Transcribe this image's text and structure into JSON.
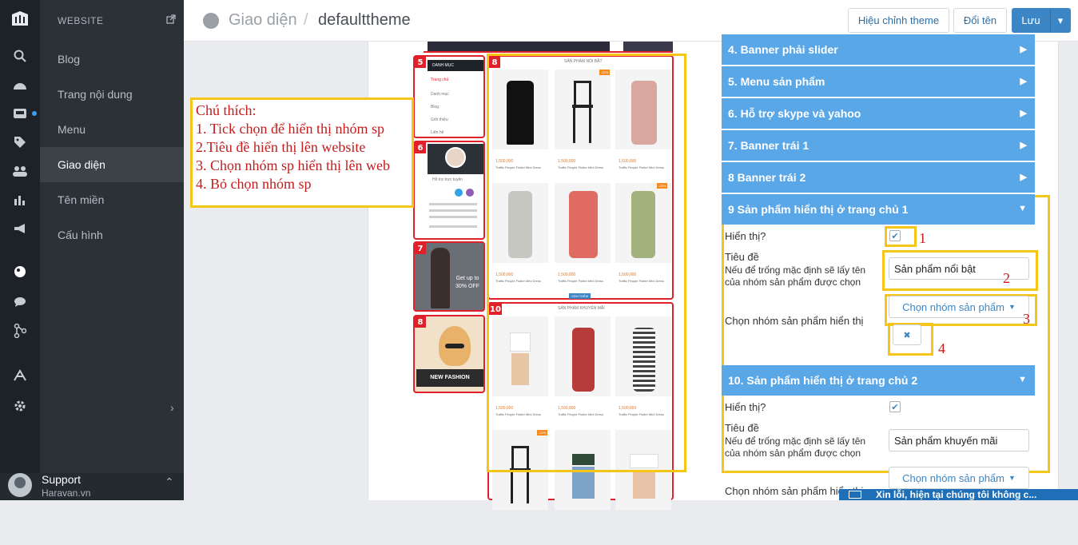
{
  "sidebar": {
    "section": "WEBSITE",
    "items": [
      {
        "label": "Blog"
      },
      {
        "label": "Trang nội dung"
      },
      {
        "label": "Menu"
      },
      {
        "label": "Giao diện",
        "active": true
      },
      {
        "label": "Tên miền"
      },
      {
        "label": "Cấu hình"
      }
    ],
    "support": {
      "name": "Support",
      "sub": "Haravan.vn"
    }
  },
  "icons": [
    "search-icon",
    "dashboard-icon",
    "inbox-icon",
    "tag-icon",
    "users-icon",
    "chart-icon",
    "megaphone-icon",
    "theme-icon",
    "chat-icon",
    "share-icon",
    "apps-icon",
    "gear-icon"
  ],
  "header": {
    "breadcrumb": "Giao diện",
    "separator": "/",
    "theme": "defaulttheme",
    "buttons": {
      "edit": "Hiệu chỉnh theme",
      "rename": "Đổi tên",
      "save": "Lưu",
      "save_caret": "▾"
    }
  },
  "preview": {
    "tags": [
      "5",
      "6",
      "7",
      "8",
      "8",
      "10"
    ],
    "menu_title": "DANH MỤC",
    "menu_items": [
      "Trang chủ",
      "Danh mục",
      "Blog",
      "Giới thiệu",
      "Liên hệ"
    ],
    "support_title": "Hỗ trợ trực tuyến",
    "sale_text": "Get up to 30% OFF",
    "fashion_text": "NEW FASHION",
    "featured_title": "SẢN PHẨM NỔI BẬT",
    "promo_title": "SẢN PHẨM KHUYẾN MÃI",
    "badge": "-22%",
    "price": "1,500,000",
    "product_name": "Traffic People Flutter Mini Dress",
    "more_button": "XEM THÊM"
  },
  "legend": {
    "title": "Chú thích:",
    "lines": [
      "1. Tick chọn để hiển thị nhóm sp",
      "2.Tiêu đề hiển thị lên website",
      "3. Chọn nhóm sp hiển thị lên web",
      "4. Bỏ chọn nhóm sp"
    ]
  },
  "settings": {
    "sections": [
      "4. Banner phải slider",
      "5. Menu sản phẩm",
      "6. Hỗ trợ skype và yahoo",
      "7. Banner trái 1",
      "8 Banner trái 2",
      "9 Sản phẩm hiển thị ở trang chủ 1",
      "10. Sản phẩm hiển thị ở trang chủ 2"
    ],
    "show_label": "Hiển thị?",
    "title_label": "Tiêu đề",
    "title_hint": "Nếu để trống mặc định sẽ lấy tên",
    "title_hint2": "của nhóm sản phẩm được chọn",
    "group_label": "Chọn nhóm sản phẩm hiển thị",
    "group_button": "Chọn nhóm sản phẩm",
    "title_value_1": "Sản phẩm nổi bật",
    "title_value_2": "Sản phẩm khuyến mãi",
    "remove_icon": "✖"
  },
  "callouts": [
    "1",
    "2",
    "3",
    "4"
  ],
  "chat": "Xin lỗi, hiện tại chúng tôi không c..."
}
